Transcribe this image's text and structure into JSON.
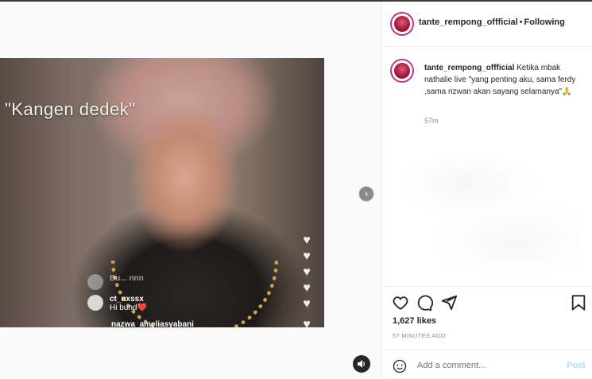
{
  "media": {
    "overlay_text": "\"Kangen dedek\"",
    "comments": [
      {
        "name": "Bu... nnn",
        "text": ""
      },
      {
        "name": "ct_nxssx",
        "text": "Hi bund❤️"
      },
      {
        "name": "nazwa_ameliasyabani",
        "text": ""
      }
    ],
    "next_icon": "chevron-right-icon",
    "sound_icon": "speaker-icon"
  },
  "header": {
    "username": "tante_rempong_offficial",
    "separator": "•",
    "follow_label": "Following"
  },
  "caption": {
    "username": "tante_rempong_offficial",
    "text": "Ketika mbak nathalie live \"yang penting aku, sama ferdy ,sama rizwan akan sayang selamanya\"🙏",
    "time": "57m"
  },
  "actions": {
    "icons": [
      "heart-icon",
      "comment-icon",
      "share-icon",
      "bookmark-icon"
    ],
    "likes": "1,627 likes",
    "time_ago": "57 MINUTES AGO"
  },
  "comment_bar": {
    "placeholder": "Add a comment...",
    "post_label": "Post"
  },
  "colors": {
    "link": "#262626",
    "muted": "#8e8e8e",
    "post_disabled": "#b3dbff",
    "avatar_ring": "#c13584"
  }
}
